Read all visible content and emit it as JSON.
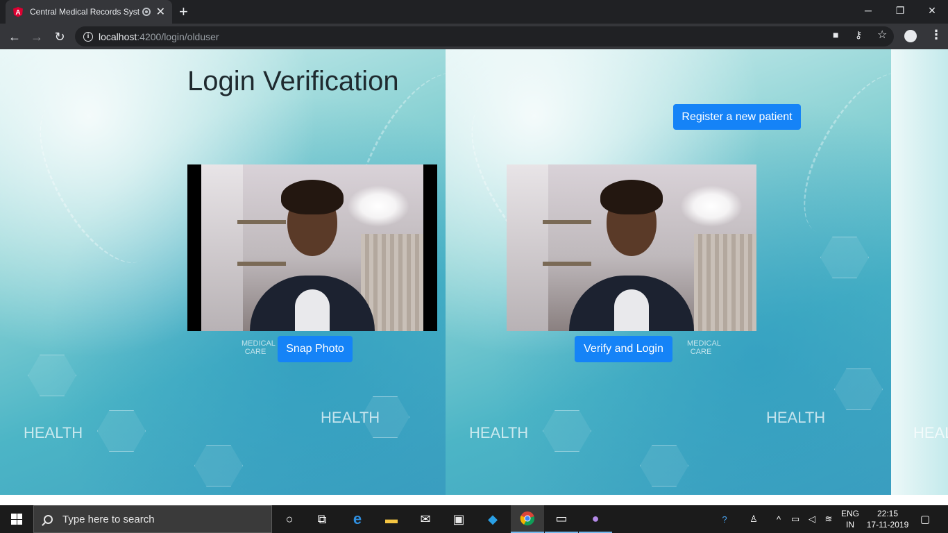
{
  "browser": {
    "tab_title": "Central Medical Records Syst",
    "new_tab_symbol": "+",
    "url_host": "localhost",
    "url_rest": ":4200/login/olduser",
    "window_controls": {
      "minimize": "─",
      "restore": "❐",
      "close": "✕"
    },
    "nav": {
      "back": "←",
      "forward": "→",
      "reload": "↻"
    }
  },
  "page": {
    "title": "Login Verification",
    "snap_button": "Snap Photo",
    "verify_button": "Verify and Login",
    "register_button": "Register a new patient",
    "background_words": [
      "HEALTH",
      "HEALTH",
      "HEALTH",
      "HEALTH",
      "MEDICAL CARE",
      "MEDICAL CARE",
      "HEALT"
    ]
  },
  "taskbar": {
    "search_placeholder": "Type here to search",
    "lang_line1": "ENG",
    "lang_line2": "IN",
    "time": "22:15",
    "date": "17-11-2019"
  },
  "colors": {
    "accent_button": "#1583f7",
    "browser_dark": "#202124",
    "toolbar": "#35363a"
  }
}
